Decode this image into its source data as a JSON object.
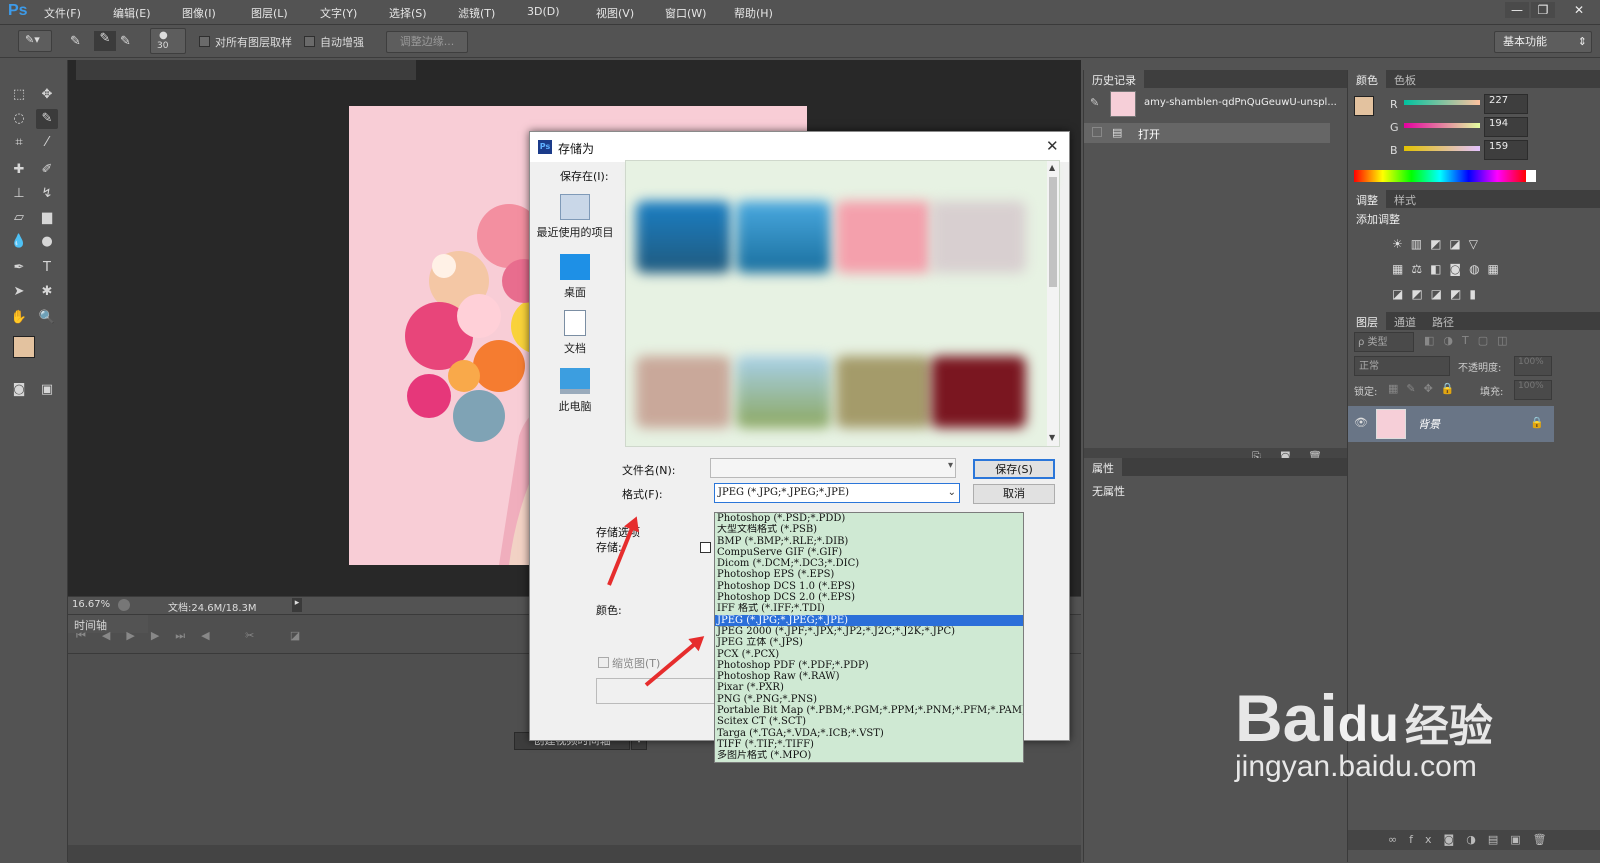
{
  "app": {
    "logo": "Ps"
  },
  "menu": [
    "文件(F)",
    "编辑(E)",
    "图像(I)",
    "图层(L)",
    "文字(Y)",
    "选择(S)",
    "滤镜(T)",
    "3D(D)",
    "视图(V)",
    "窗口(W)",
    "帮助(H)"
  ],
  "window_buttons": [
    "—",
    "❐",
    "✕"
  ],
  "options": {
    "brush_size": "30",
    "sample_all_label": "对所有图层取样",
    "auto_enhance_label": "自动增强",
    "refine_edge_label": "调整边缘...",
    "workspace": "基本功能"
  },
  "status": {
    "zoom": "16.67%",
    "doc": "文档:24.6M/18.3M"
  },
  "timeline": {
    "tab": "时间轴",
    "create_button": "创建视频时间轴"
  },
  "history": {
    "tab": "历史记录",
    "snapshot": "amy-shamblen-qdPnQuGeuwU-unspl...",
    "item": "打开"
  },
  "properties": {
    "tab": "属性",
    "empty": "无属性"
  },
  "color_panel": {
    "tabs": [
      "颜色",
      "色板"
    ],
    "r_label": "R",
    "g_label": "G",
    "b_label": "B",
    "r": "227",
    "g": "194",
    "b": "159",
    "fg_color": "#e3c29f"
  },
  "adjust_panel": {
    "tabs": [
      "调整",
      "样式"
    ],
    "heading": "添加调整"
  },
  "layers_panel": {
    "tabs": [
      "图层",
      "通道",
      "路径"
    ],
    "filter": "ρ 类型",
    "blend": "正常",
    "opacity_label": "不透明度:",
    "opacity": "100%",
    "lock_label": "锁定:",
    "fill_label": "填充:",
    "fill": "100%",
    "layer_name": "背景"
  },
  "dialog": {
    "title": "存储为",
    "save_in_label": "保存在(I):",
    "places": [
      "最近使用的项目",
      "桌面",
      "文档",
      "此电脑"
    ],
    "filename_label": "文件名(N):",
    "format_label": "格式(F):",
    "format_value": "JPEG (*.JPG;*.JPEG;*.JPE)",
    "save_button": "保存(S)",
    "cancel_button": "取消",
    "options_label": "存储选项",
    "store_label": "存储:",
    "color_label": "颜色:",
    "thumbnail_label": "缩览图(T)"
  },
  "format_options": [
    "Photoshop (*.PSD;*.PDD)",
    "大型文档格式 (*.PSB)",
    "BMP (*.BMP;*.RLE;*.DIB)",
    "CompuServe GIF (*.GIF)",
    "Dicom (*.DCM;*.DC3;*.DIC)",
    "Photoshop EPS (*.EPS)",
    "Photoshop DCS 1.0 (*.EPS)",
    "Photoshop DCS 2.0 (*.EPS)",
    "IFF 格式 (*.IFF;*.TDI)",
    "JPEG (*.JPG;*.JPEG;*.JPE)",
    "JPEG 2000 (*.JPF;*.JPX;*.JP2;*.J2C;*.J2K;*.JPC)",
    "JPEG 立体 (*.JPS)",
    "PCX (*.PCX)",
    "Photoshop PDF (*.PDF;*.PDP)",
    "Photoshop Raw (*.RAW)",
    "Pixar (*.PXR)",
    "PNG (*.PNG;*.PNS)",
    "Portable Bit Map (*.PBM;*.PGM;*.PPM;*.PNM;*.PFM;*.PAM)",
    "Scitex CT (*.SCT)",
    "Targa (*.TGA;*.VDA;*.ICB;*.VST)",
    "TIFF (*.TIF;*.TIFF)",
    "多图片格式 (*.MPO)"
  ],
  "selected_format_index": 9,
  "watermark": {
    "logo": "Bai",
    "paw": "du",
    "cn": "经验",
    "url": "jingyan.baidu.com"
  }
}
